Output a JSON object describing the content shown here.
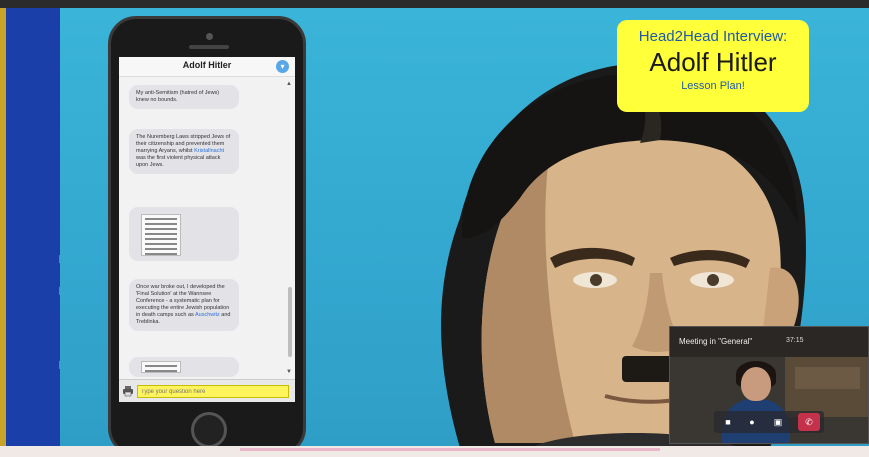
{
  "brand": {
    "site": "activehistory.co.uk"
  },
  "phone": {
    "chat_title": "Adolf Hitler",
    "messages": [
      {
        "text": "My anti-Semitism (hatred of Jews) knew no bounds."
      },
      {
        "text_before": "The Nuremberg Laws stripped Jews of their citizenship and prevented them marrying Aryans, whilst ",
        "link": "Kristallnacht",
        "text_after": " was the first violent physical attack upon Jews."
      },
      {
        "image": "newspaper-clipping"
      },
      {
        "text_before": "Once war broke out, I developed the 'Final Solution' at the Wannsee Conference - a systematic plan for executing the entire Jewish population in death camps such as ",
        "link": "Auschwitz",
        "text_after": " and Treblinka."
      },
      {
        "image": "newspaper-clipping"
      }
    ],
    "input_placeholder": "Type your question here"
  },
  "badge": {
    "line1": "Head2Head Interview:",
    "line2": "Adolf Hitler",
    "line3": "Lesson Plan!"
  },
  "meeting": {
    "title": "Meeting in \"General\"",
    "timer": "37:15",
    "controls": [
      "video-camera-icon",
      "microphone-icon",
      "share-screen-icon",
      "hang-up-icon"
    ]
  },
  "colors": {
    "stage_blue": "#33a7cf",
    "brand_blue": "#1b3fa8",
    "brand_yellow": "#f6c400",
    "badge_yellow": "#ffff3a",
    "hangup_red": "#c4314b"
  }
}
